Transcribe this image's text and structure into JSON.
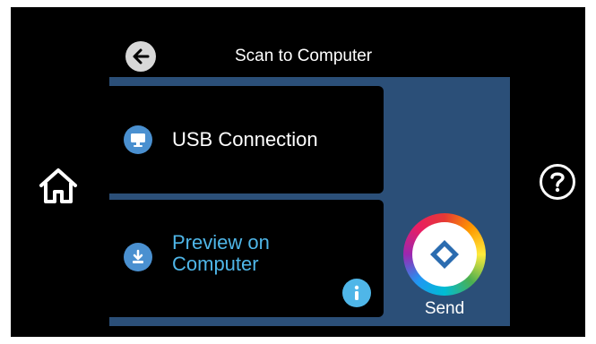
{
  "header": {
    "title": "Scan to Computer",
    "back_icon": "back-arrow-icon"
  },
  "options": [
    {
      "label": "USB Connection",
      "icon": "monitor-icon",
      "color": "#ffffff"
    },
    {
      "label": "Preview on Computer",
      "icon": "download-icon",
      "color": "#4fb6e8"
    }
  ],
  "actions": {
    "send_label": "Send",
    "info_icon": "info-icon",
    "home_icon": "home-icon",
    "help_icon": "help-icon"
  },
  "colors": {
    "panel": "#2b4f78",
    "accent": "#4fb6e8",
    "background": "#000000"
  }
}
